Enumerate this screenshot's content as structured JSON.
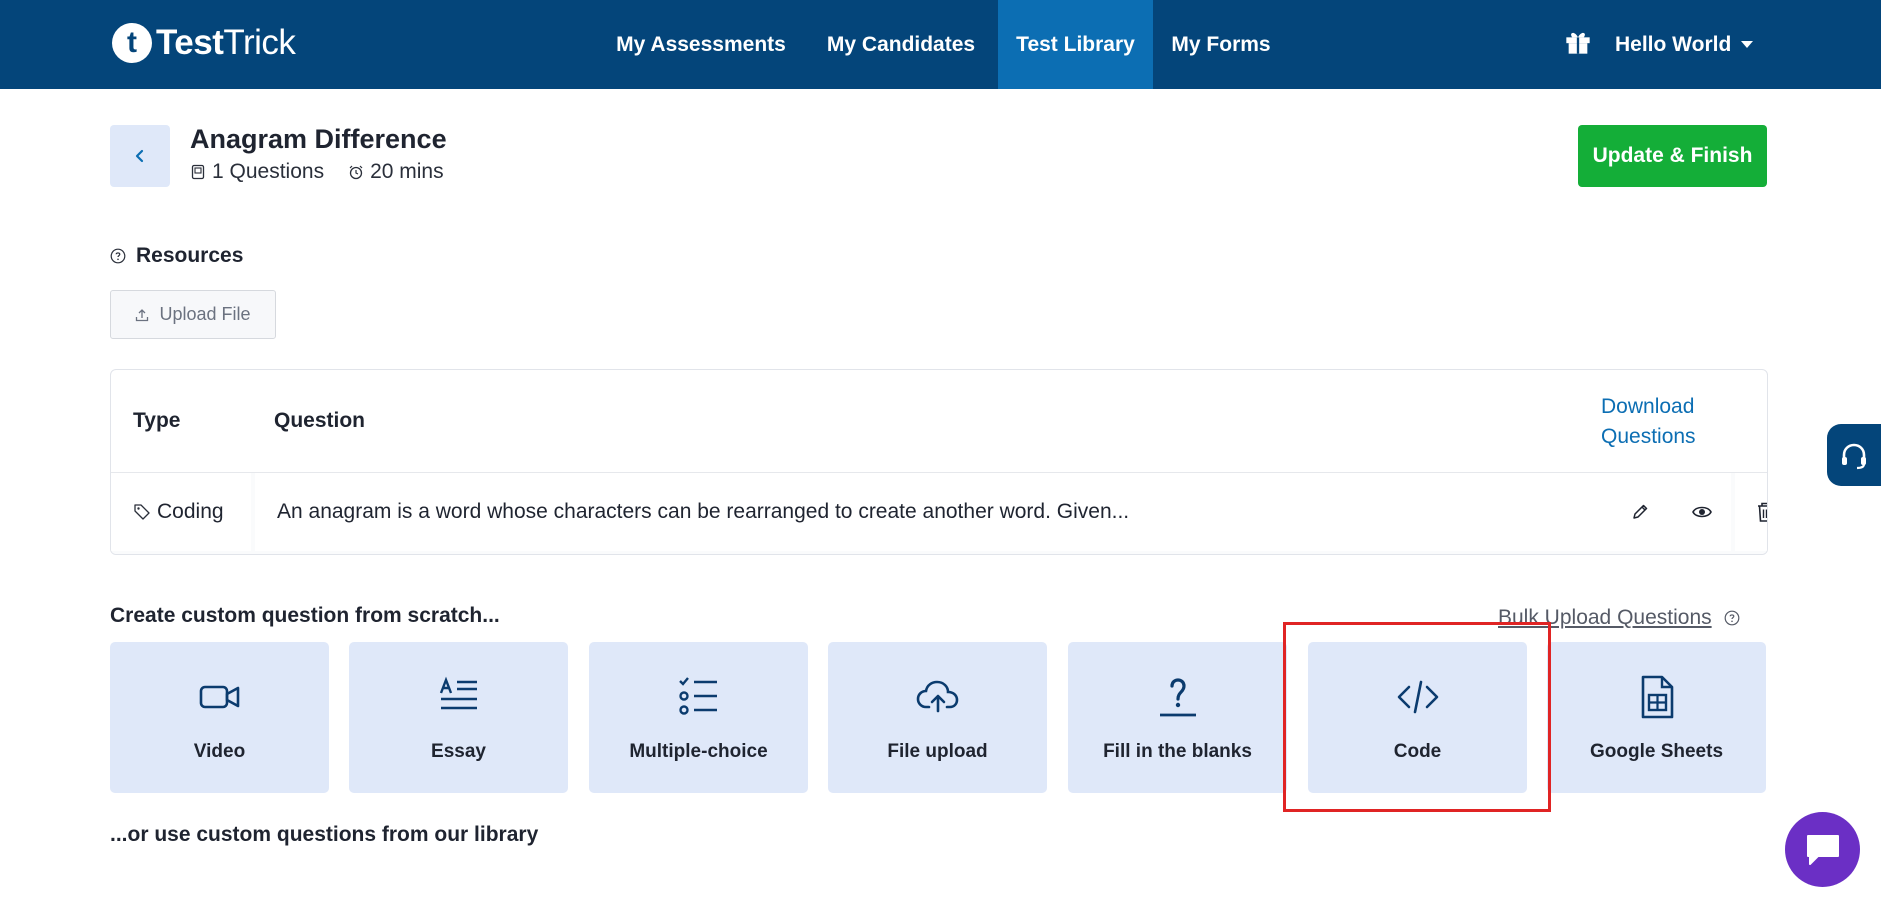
{
  "nav": {
    "logo_bold": "Test",
    "logo_light": "Trick",
    "logo_mark": "t",
    "items": [
      "My Assessments",
      "My Candidates",
      "Test Library",
      "My Forms"
    ],
    "active_item": "Test Library",
    "user_name": "Hello World"
  },
  "header": {
    "title": "Anagram Difference",
    "questions_count": "1 Questions",
    "duration": "20 mins",
    "update_button": "Update & Finish"
  },
  "resources": {
    "label": "Resources",
    "upload_button": "Upload File"
  },
  "table": {
    "col_type": "Type",
    "col_question": "Question",
    "download_line1": "Download",
    "download_line2": "Questions",
    "rows": [
      {
        "type": "Coding",
        "question": "An anagram is a word whose characters can be rearranged to create another word. Given..."
      }
    ]
  },
  "create": {
    "label": "Create custom question from scratch...",
    "bulk_upload": "Bulk Upload Questions",
    "cards": [
      {
        "label": "Video",
        "icon": "video-icon"
      },
      {
        "label": "Essay",
        "icon": "essay-icon"
      },
      {
        "label": "Multiple-choice",
        "icon": "checklist-icon"
      },
      {
        "label": "File upload",
        "icon": "cloud-upload-icon"
      },
      {
        "label": "Fill in the blanks",
        "icon": "question-mark-icon"
      },
      {
        "label": "Code",
        "icon": "code-icon"
      },
      {
        "label": "Google Sheets",
        "icon": "spreadsheet-icon"
      }
    ],
    "highlighted_card": "Code"
  },
  "library_label": "...or use custom questions from our library",
  "colors": {
    "nav_bg": "#04457a",
    "nav_active": "#0c6eb3",
    "primary_green": "#14ae38",
    "card_bg": "#dfe8f9",
    "icon_blue": "#0b3b6e",
    "link_blue": "#0c6eb3",
    "highlight_red": "#e02424",
    "chat_purple": "#6b2fc5"
  }
}
